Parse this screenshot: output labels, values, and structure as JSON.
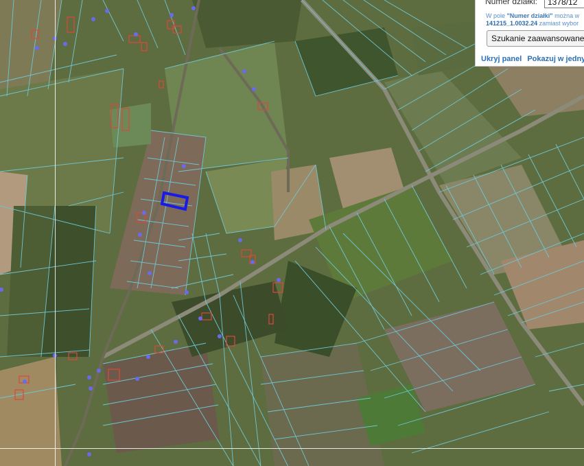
{
  "panel": {
    "parcel_label": "Numer działki:",
    "parcel_value": "1378/12",
    "hint_prefix": "W pole ",
    "hint_field": "\"Numer działki\"",
    "hint_suffix": " można w",
    "hint_example": "141215_1.0032.24",
    "hint_example_suffix": " zamiast wybor",
    "advanced_button": "Szukanie zaawansowane",
    "hide_panel_link": "Ukryj panel",
    "show_in_link": "Pokazuj w jednym"
  },
  "colors": {
    "parcel_line": "#6fc6d4",
    "selected_parcel": "#1a1ae8",
    "address_point": "#6a6af0",
    "building_outline": "#e0453a",
    "link": "#2a6fb8"
  }
}
